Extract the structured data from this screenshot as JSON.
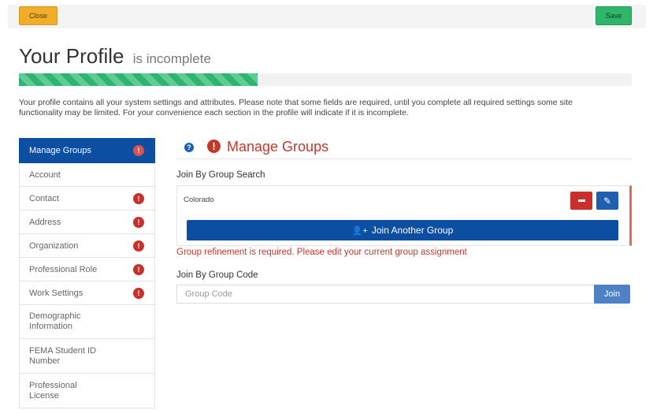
{
  "toolbar": {
    "close_label": "Close",
    "save_label": "Save"
  },
  "header": {
    "title": "Your Profile",
    "subtitle": "is incomplete"
  },
  "progress": {
    "percent": 39,
    "color": "#2eb371"
  },
  "intro_text": "Your profile contains all your system settings and attributes. Please note that some fields are required, until you complete all required settings some site functionality may be limited. For your convenience each section in the profile will indicate if it is incomplete.",
  "sidebar": {
    "items": [
      {
        "label": "Manage Groups",
        "badge": "!"
      },
      {
        "label": "Account"
      },
      {
        "label": "Contact",
        "badge": "!"
      },
      {
        "label": "Address",
        "badge": "!"
      },
      {
        "label": "Organization",
        "badge": "!"
      },
      {
        "label": "Professional Role",
        "badge": "!"
      },
      {
        "label": "Work Settings",
        "badge": "!"
      },
      {
        "label": "Demographic Information"
      },
      {
        "label": "FEMA Student ID Number"
      },
      {
        "label": "Professional License"
      }
    ]
  },
  "main": {
    "section_title": "Manage Groups",
    "join_search_label": "Join By Group Search",
    "group_name": "Colorado",
    "join_another_label": "Join Another Group",
    "error_message": "Group refinement is required. Please edit your current group assignment",
    "join_code_label": "Join By Group Code",
    "code_placeholder": "Group Code",
    "join_button_label": "Join"
  },
  "colors": {
    "primary": "#0b4ea2",
    "danger": "#c0392b",
    "warning": "#f0ad2a",
    "success": "#2fb66b"
  }
}
